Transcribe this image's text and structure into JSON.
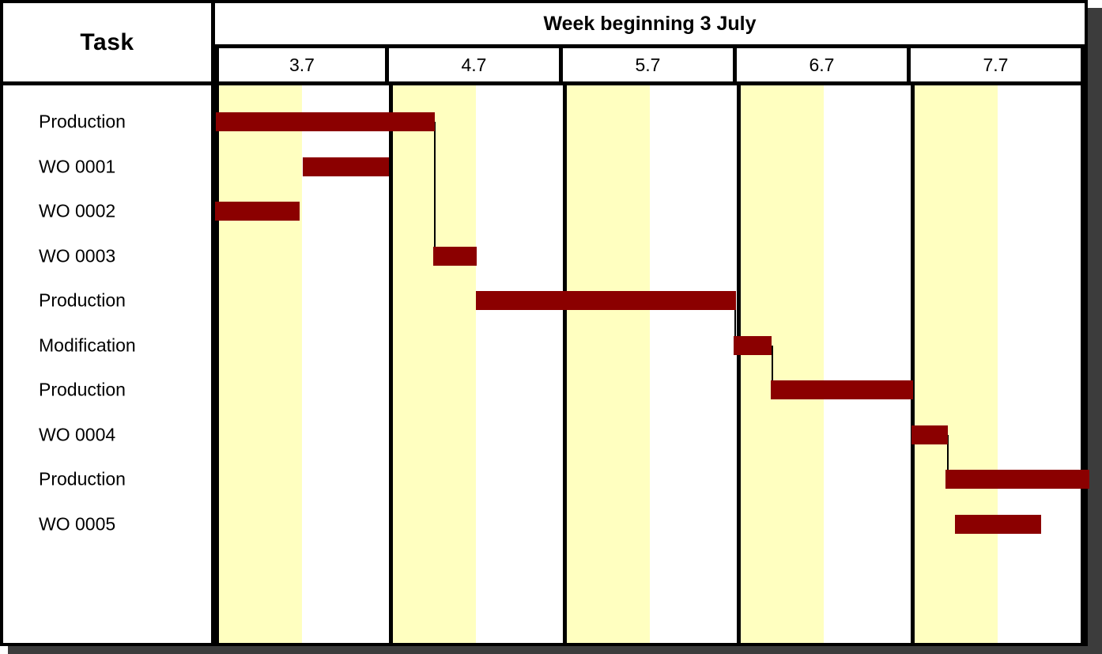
{
  "chart_data": {
    "type": "bar",
    "title": "Week beginning 3 July",
    "subtitle": "",
    "xlabel": "",
    "ylabel": "Task",
    "orientation": "horizontal-gantt",
    "categories": [
      "Production",
      "WO 0001",
      "WO 0002",
      "WO 0003",
      "Production",
      "Modification",
      "Production",
      "WO 0004",
      "Production",
      "WO 0005"
    ],
    "day_columns": [
      "3.7",
      "4.7",
      "5.7",
      "6.7",
      "7.7"
    ],
    "half_day_slots": 10,
    "xlim": [
      0,
      10
    ],
    "grid": true,
    "legend": "none",
    "bar_color": "#8b0000",
    "shaded_band_color": "#ffffc0",
    "tasks": [
      {
        "label": "Production",
        "start_slot": 0.01,
        "end_slot": 2.53,
        "row": 0
      },
      {
        "label": "WO 0001",
        "start_slot": 1.01,
        "end_slot": 2.0,
        "row": 1
      },
      {
        "label": "WO 0002",
        "start_slot": 0.0,
        "end_slot": 0.97,
        "row": 2
      },
      {
        "label": "WO 0003",
        "start_slot": 2.51,
        "end_slot": 3.01,
        "row": 3
      },
      {
        "label": "Production",
        "start_slot": 3.0,
        "end_slot": 5.99,
        "row": 4
      },
      {
        "label": "Modification",
        "start_slot": 5.96,
        "end_slot": 6.4,
        "row": 5
      },
      {
        "label": "Production",
        "start_slot": 6.39,
        "end_slot": 8.03,
        "row": 6
      },
      {
        "label": "WO 0004",
        "start_slot": 8.01,
        "end_slot": 8.43,
        "row": 7
      },
      {
        "label": "Production",
        "start_slot": 8.4,
        "end_slot": 10.05,
        "row": 8
      },
      {
        "label": "WO 0005",
        "start_slot": 8.51,
        "end_slot": 9.5,
        "row": 9
      }
    ],
    "dependency_links": [
      {
        "from_row": 0,
        "to_row": 3,
        "at_slot": 2.52
      },
      {
        "from_row": 4,
        "to_row": 5,
        "at_slot": 5.97
      },
      {
        "from_row": 5,
        "to_row": 6,
        "at_slot": 6.4
      },
      {
        "from_row": 6,
        "to_row": 7,
        "at_slot": 8.02
      },
      {
        "from_row": 7,
        "to_row": 8,
        "at_slot": 8.42
      }
    ]
  },
  "header": {
    "task_column_label": "Task",
    "week_label": "Week beginning 3 July",
    "days": [
      {
        "label": "3.7"
      },
      {
        "label": "4.7"
      },
      {
        "label": "5.7"
      },
      {
        "label": "6.7"
      },
      {
        "label": "7.7"
      }
    ]
  },
  "rows": [
    {
      "label": "Production"
    },
    {
      "label": "WO 0001"
    },
    {
      "label": "WO 0002"
    },
    {
      "label": "WO 0003"
    },
    {
      "label": "Production"
    },
    {
      "label": "Modification"
    },
    {
      "label": "Production"
    },
    {
      "label": "WO 0004"
    },
    {
      "label": "Production"
    },
    {
      "label": "WO 0005"
    }
  ],
  "colors": {
    "bar": "#8b0000",
    "shaded_band": "#ffffc0",
    "grid_line": "#000000",
    "background": "#ffffff",
    "shadow": "#3c3c3c"
  }
}
